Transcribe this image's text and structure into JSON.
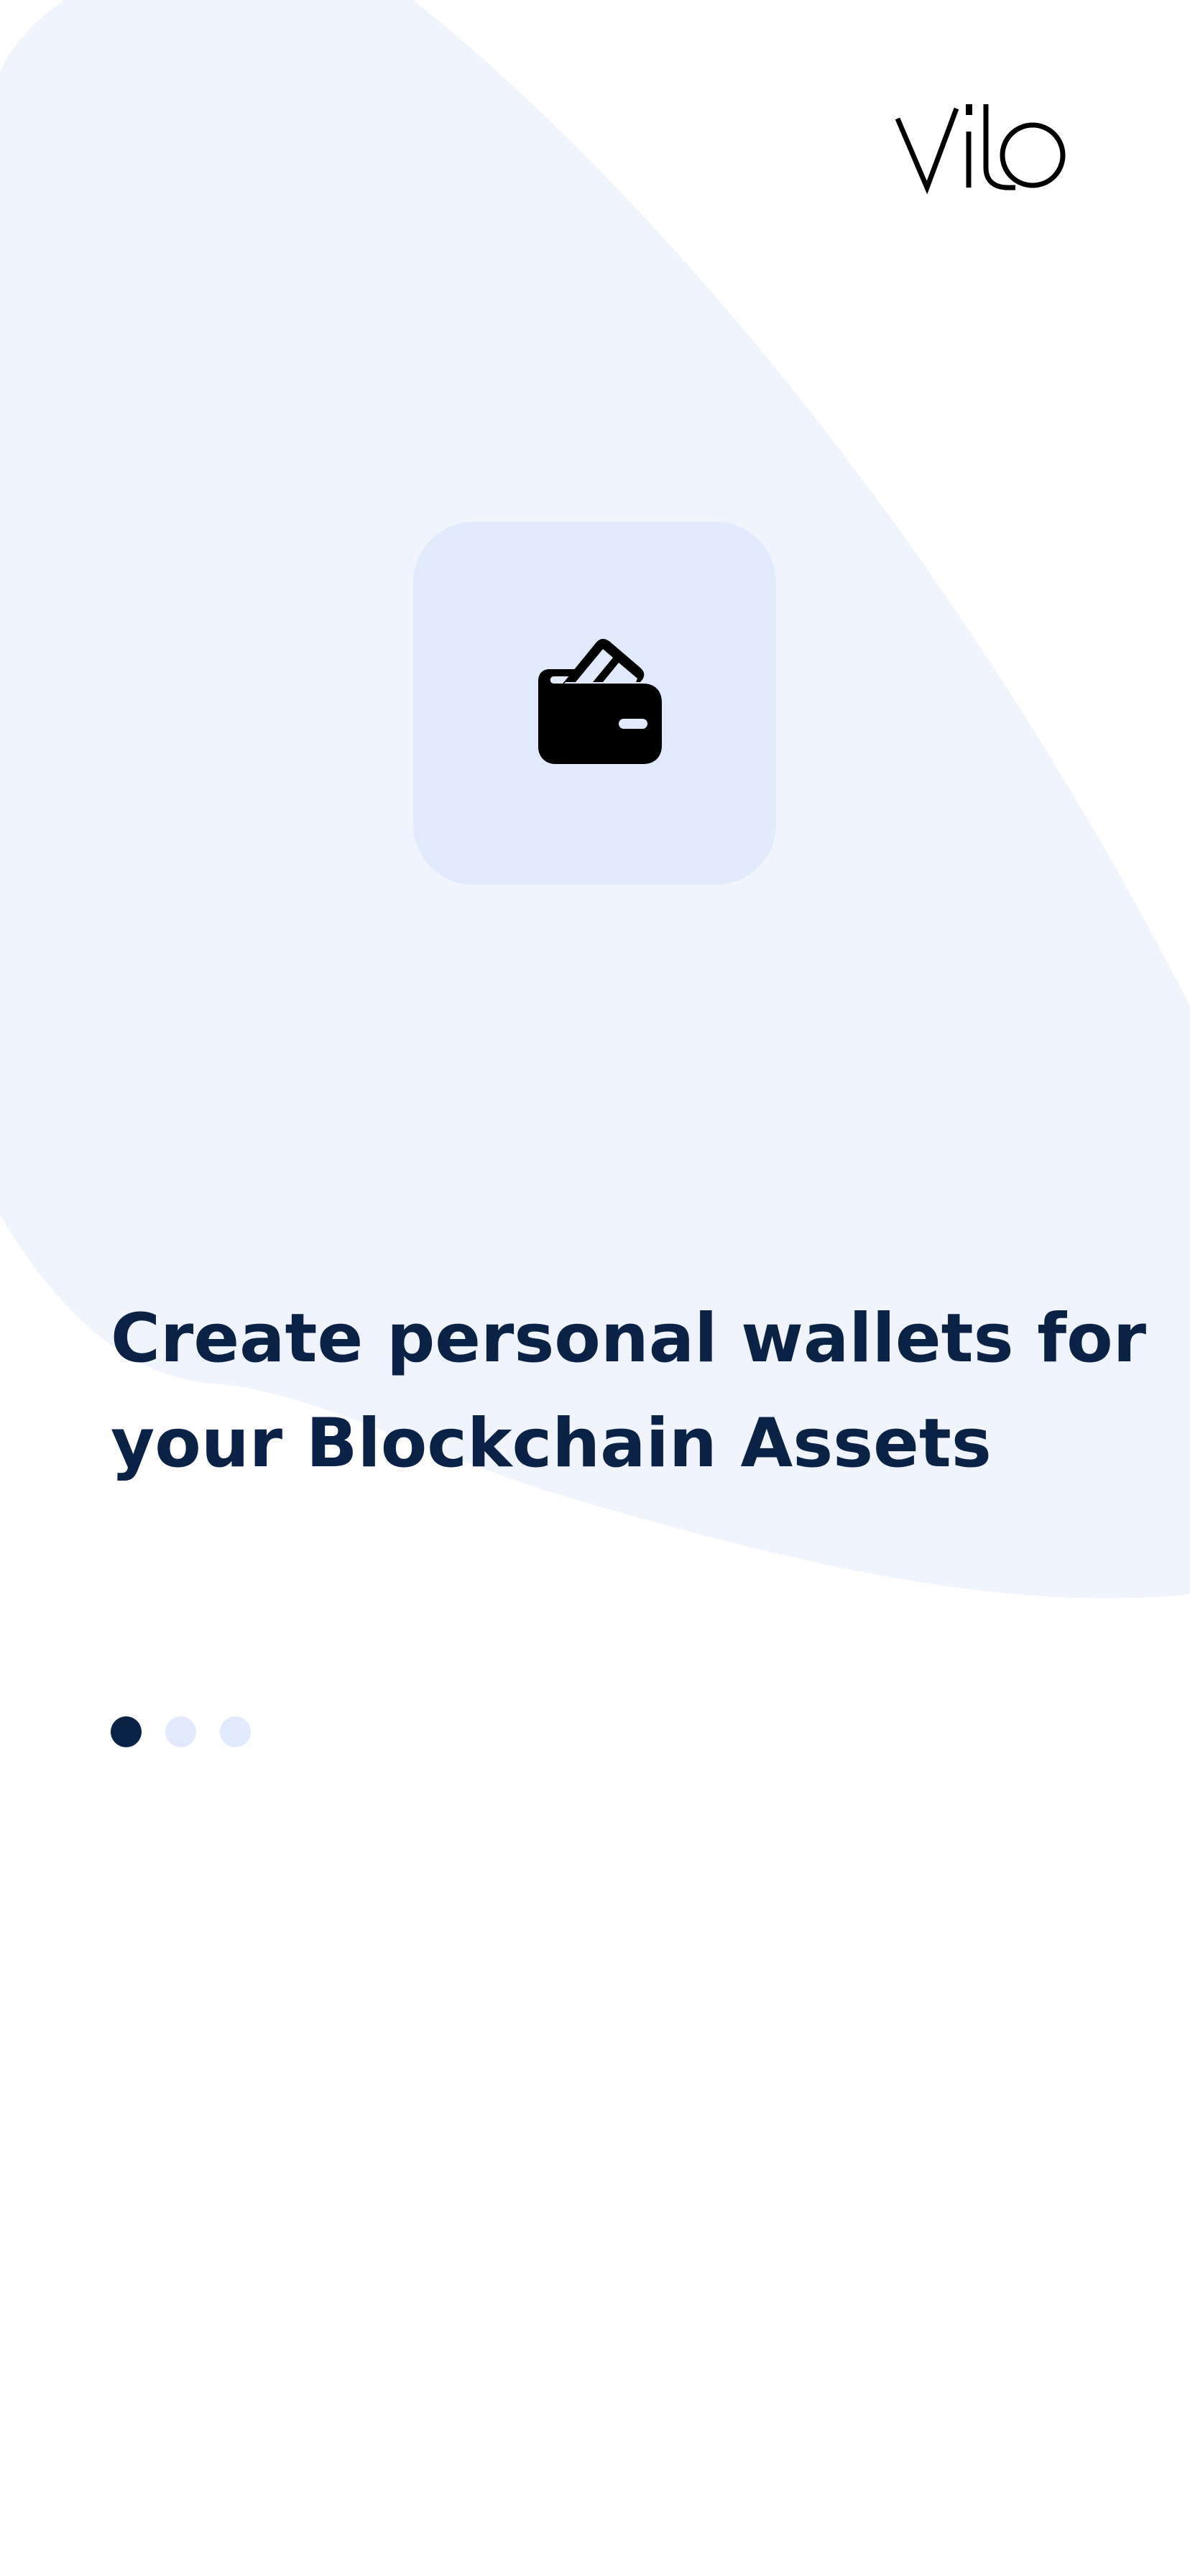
{
  "app": {
    "brand": "vilo"
  },
  "onboarding": {
    "illustration_icon": "wallet-icon",
    "headline_line1": "Create personal wallets for",
    "headline_line2": "your Blockchain Assets",
    "pager": {
      "total": 3,
      "active_index": 0
    }
  },
  "colors": {
    "background": "#ffffff",
    "blob": "#eff4fd",
    "tile": "#e1eafd",
    "headline": "#0b2247",
    "dot_active": "#0b2247",
    "dot_inactive": "#e1eafd",
    "icon": "#000000"
  }
}
